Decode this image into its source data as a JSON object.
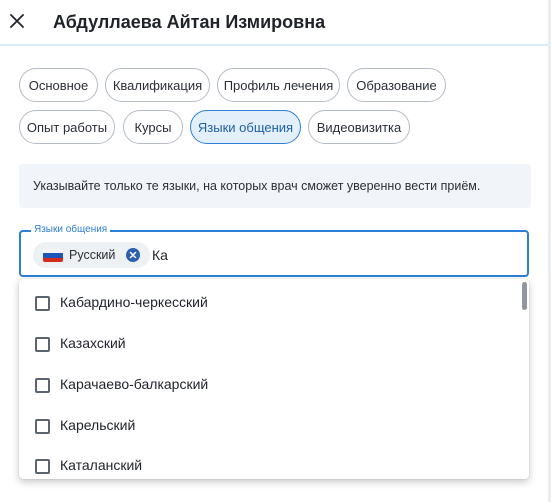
{
  "header": {
    "title": "Абдуллаева Айтан Измировна",
    "close_icon": "close-icon"
  },
  "tabs": [
    {
      "label": "Основное",
      "active": false
    },
    {
      "label": "Квалификация",
      "active": false
    },
    {
      "label": "Профиль лечения",
      "active": false
    },
    {
      "label": "Образование",
      "active": false
    },
    {
      "label": "Опыт работы",
      "active": false
    },
    {
      "label": "Курсы",
      "active": false
    },
    {
      "label": "Языки общения",
      "active": true
    },
    {
      "label": "Видеовизитка",
      "active": false
    }
  ],
  "notice": {
    "text": "Указывайте только те языки, на которых врач сможет уверенно вести приём."
  },
  "languages_field": {
    "label": "Языки общения",
    "selected_chip": {
      "label": "Русский",
      "icon": "russia-flag-icon"
    },
    "input_value": "Ка"
  },
  "dropdown": {
    "options": [
      {
        "label": "Кабардино-черкесский",
        "checked": false
      },
      {
        "label": "Казахский",
        "checked": false
      },
      {
        "label": "Карачаево-балкарский",
        "checked": false
      },
      {
        "label": "Карельский",
        "checked": false
      },
      {
        "label": "Каталанский",
        "checked": false
      }
    ]
  },
  "colors": {
    "accent": "#2b7fd6",
    "active_tab_bg": "#e3f0fc",
    "notice_bg": "#f1f5f9",
    "chip_bg": "#eef1f4"
  }
}
